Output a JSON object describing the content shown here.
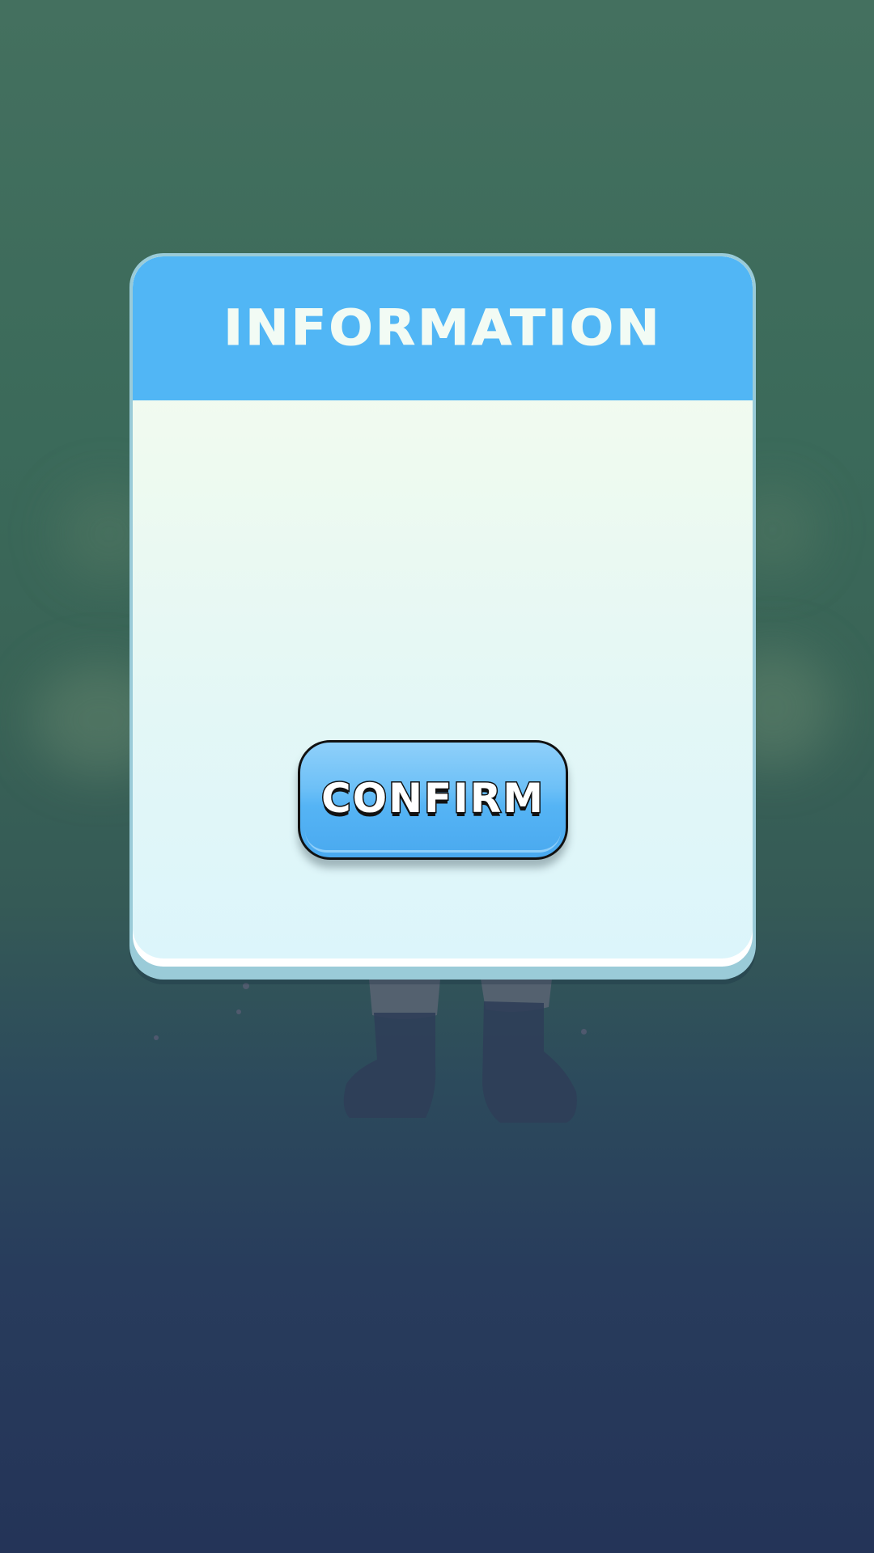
{
  "dialog": {
    "title": "INFORMATION",
    "confirm_label": "CONFIRM"
  },
  "colors": {
    "header": "#51b6f5",
    "title_text": "#f2fbf4",
    "button": "#55b4f5",
    "button_outline": "#111111"
  }
}
